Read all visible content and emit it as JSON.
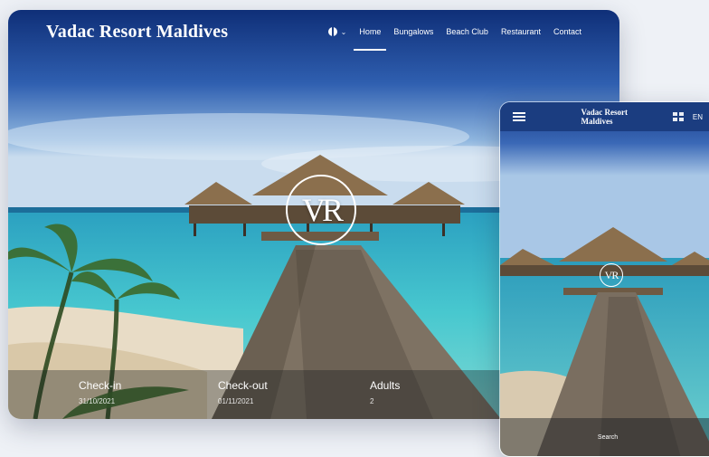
{
  "desktop": {
    "brand": "Vadac Resort Maldives",
    "nav": [
      {
        "label": "Home",
        "active": true
      },
      {
        "label": "Bungalows",
        "active": false
      },
      {
        "label": "Beach Club",
        "active": false
      },
      {
        "label": "Restaurant",
        "active": false
      },
      {
        "label": "Contact",
        "active": false
      }
    ],
    "logo": "VR",
    "booking": {
      "checkin_label": "Check-in",
      "checkin_value": "31/10/2021",
      "checkout_label": "Check-out",
      "checkout_value": "01/11/2021",
      "adults_label": "Adults",
      "adults_value": "2"
    }
  },
  "mobile": {
    "brand": "Vadac Resort Maldives",
    "lang": "EN",
    "logo": "VR",
    "search_label": "Search"
  },
  "icons": [
    "globe-icon",
    "chevron-down-icon",
    "hamburger-icon",
    "flag-icon",
    "logo-mark"
  ],
  "colors": {
    "sky_top": "#163c8c",
    "sea": "#34b8c8",
    "sand": "#e9ddc7",
    "nav_dark": "#1b3d80"
  }
}
